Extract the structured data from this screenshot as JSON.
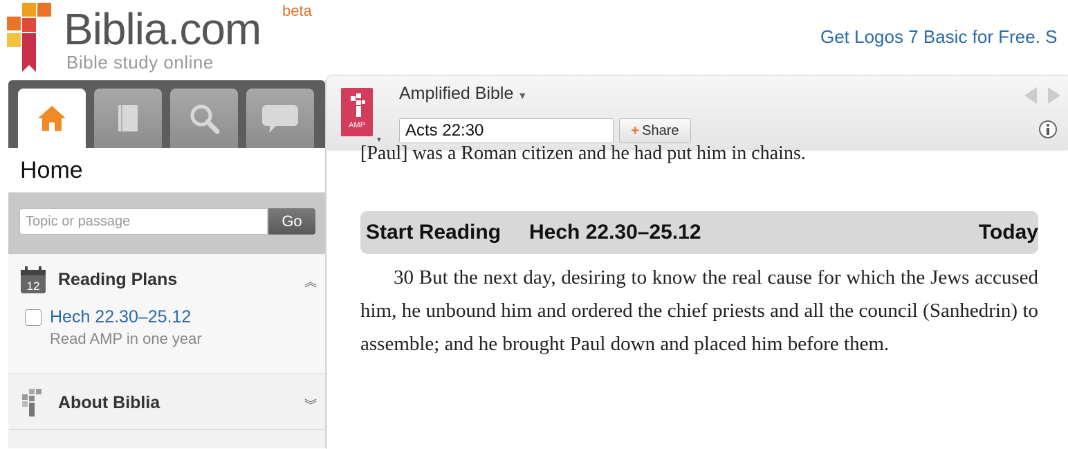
{
  "header": {
    "logo_text": "Biblia.com",
    "logo_tagline": "Bible study online",
    "logo_badge": "beta",
    "promo_text": "Get Logos 7 Basic for Free. S"
  },
  "sidebar": {
    "tabs": [
      {
        "icon": "home-icon",
        "active": true
      },
      {
        "icon": "book-icon",
        "active": false
      },
      {
        "icon": "search-icon",
        "active": false
      },
      {
        "icon": "speech-bubble-icon",
        "active": false
      }
    ],
    "title": "Home",
    "search": {
      "placeholder": "Topic or passage",
      "go_label": "Go"
    },
    "reading_plans": {
      "title": "Reading Plans",
      "calendar_day": "12",
      "plan_link": "Hech 22.30–25.12",
      "plan_sub": "Read AMP in one year"
    },
    "about": {
      "title": "About Biblia"
    }
  },
  "toolbar": {
    "amp_label": "AMP",
    "version": "Amplified Bible",
    "reference": "Acts 22:30",
    "share_label": "Share"
  },
  "content": {
    "prev_verse": "[Paul] was a Roman citizen and he had put him in chains.",
    "reading_bar": {
      "start": "Start Reading",
      "range": "Hech 22.30–25.12",
      "today": "Today"
    },
    "passage": "30 But the next day, desiring to know the real cause for which the Jews accused him, he unbound him and ordered the chief priests and all the council (Sanhedrin) to assemble; and he brought Paul down and placed him before them."
  },
  "colors": {
    "accent_orange": "#e8742a",
    "link_blue": "#2a6aa8",
    "amp_red": "#d43c5c"
  }
}
